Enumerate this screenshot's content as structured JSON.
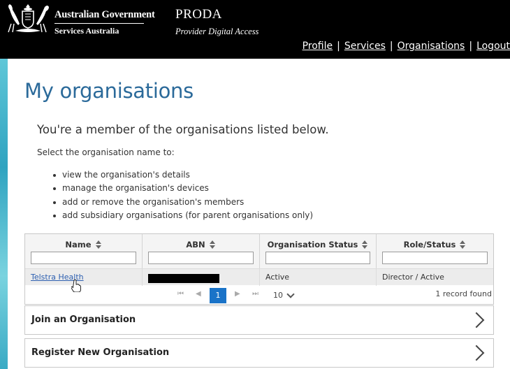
{
  "header": {
    "gov_line1": "Australian Government",
    "gov_line2": "Services Australia",
    "title": "PRODA",
    "subtitle": "Provider Digital Access",
    "nav": [
      "Profile",
      "Services",
      "Organisations",
      "Logout"
    ],
    "nav_separator": "|"
  },
  "page": {
    "title": "My organisations",
    "intro": "You're a member of the organisations listed below.",
    "instruction": "Select the organisation name to:",
    "bullets": [
      "view the organisation's details",
      "manage the organisation's devices",
      "add or remove the organisation's members",
      "add subsidiary organisations (for parent organisations only)"
    ]
  },
  "table": {
    "columns": [
      "Name",
      "ABN",
      "Organisation Status",
      "Role/Status"
    ],
    "rows": [
      {
        "name": "Telstra Health",
        "status": "Active",
        "role": "Director / Active"
      }
    ],
    "pager": {
      "first": "⏮",
      "prev": "◀",
      "current": "1",
      "next": "▶",
      "last": "⏭",
      "page_size": "10",
      "records": "1 record found"
    }
  },
  "actions": {
    "join": "Join an Organisation",
    "register": "Register New Organisation"
  },
  "colors": {
    "header_bg": "#000000",
    "title_blue": "#2b6a9a",
    "link_blue": "#2d5fb0",
    "pager_active": "#1a73c8",
    "accent_teal": "#2fa3c0"
  }
}
